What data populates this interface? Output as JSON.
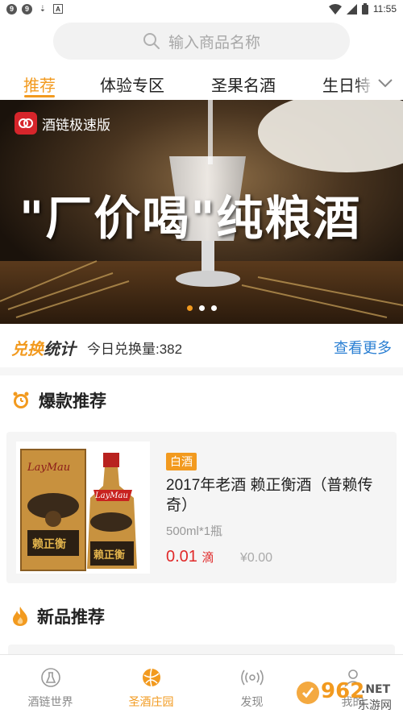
{
  "status_bar": {
    "time": "11:55",
    "left_icons": [
      "notification-9",
      "notification-9",
      "download-icon",
      "app-a-icon"
    ],
    "left_glyphs": [
      "9",
      "9",
      "⇣",
      "A"
    ]
  },
  "search": {
    "placeholder": "输入商品名称"
  },
  "tabs": [
    {
      "label": "推荐",
      "active": true
    },
    {
      "label": "体验专区",
      "active": false
    },
    {
      "label": "圣果名酒",
      "active": false
    },
    {
      "label": "生日特",
      "active": false
    }
  ],
  "banner": {
    "logo_text": "酒链极速版",
    "slogan": "\"厂价喝\"纯粮酒",
    "dots": 3,
    "active_dot": 0
  },
  "exchange": {
    "logo_accent": "兑换",
    "logo_dark": "统计",
    "today_label": "今日兑换量:382",
    "more_label": "查看更多"
  },
  "hot_section": {
    "title": "爆款推荐"
  },
  "product": {
    "tag": "白酒",
    "name": "2017年老酒 赖正衡酒（普赖传奇）",
    "spec": "500ml*1瓶",
    "price": "0.01",
    "price_unit": "滴",
    "original_price": "¥0.00",
    "brand_text": "LayMau",
    "bottle_label": "赖正衡"
  },
  "new_section": {
    "title": "新品推荐"
  },
  "bottom_nav": [
    {
      "label": "酒链世界",
      "icon": "flask-icon",
      "active": false
    },
    {
      "label": "圣酒庄园",
      "icon": "ball-icon",
      "active": true
    },
    {
      "label": "发现",
      "icon": "radar-icon",
      "active": false
    },
    {
      "label": "我的",
      "icon": "user-icon",
      "active": false
    }
  ],
  "watermark": {
    "number": "962",
    "suffix": ".NET",
    "sub": "乐游网"
  },
  "colors": {
    "accent": "#f29a1f",
    "price": "#e02929",
    "link": "#2a7fd3"
  }
}
